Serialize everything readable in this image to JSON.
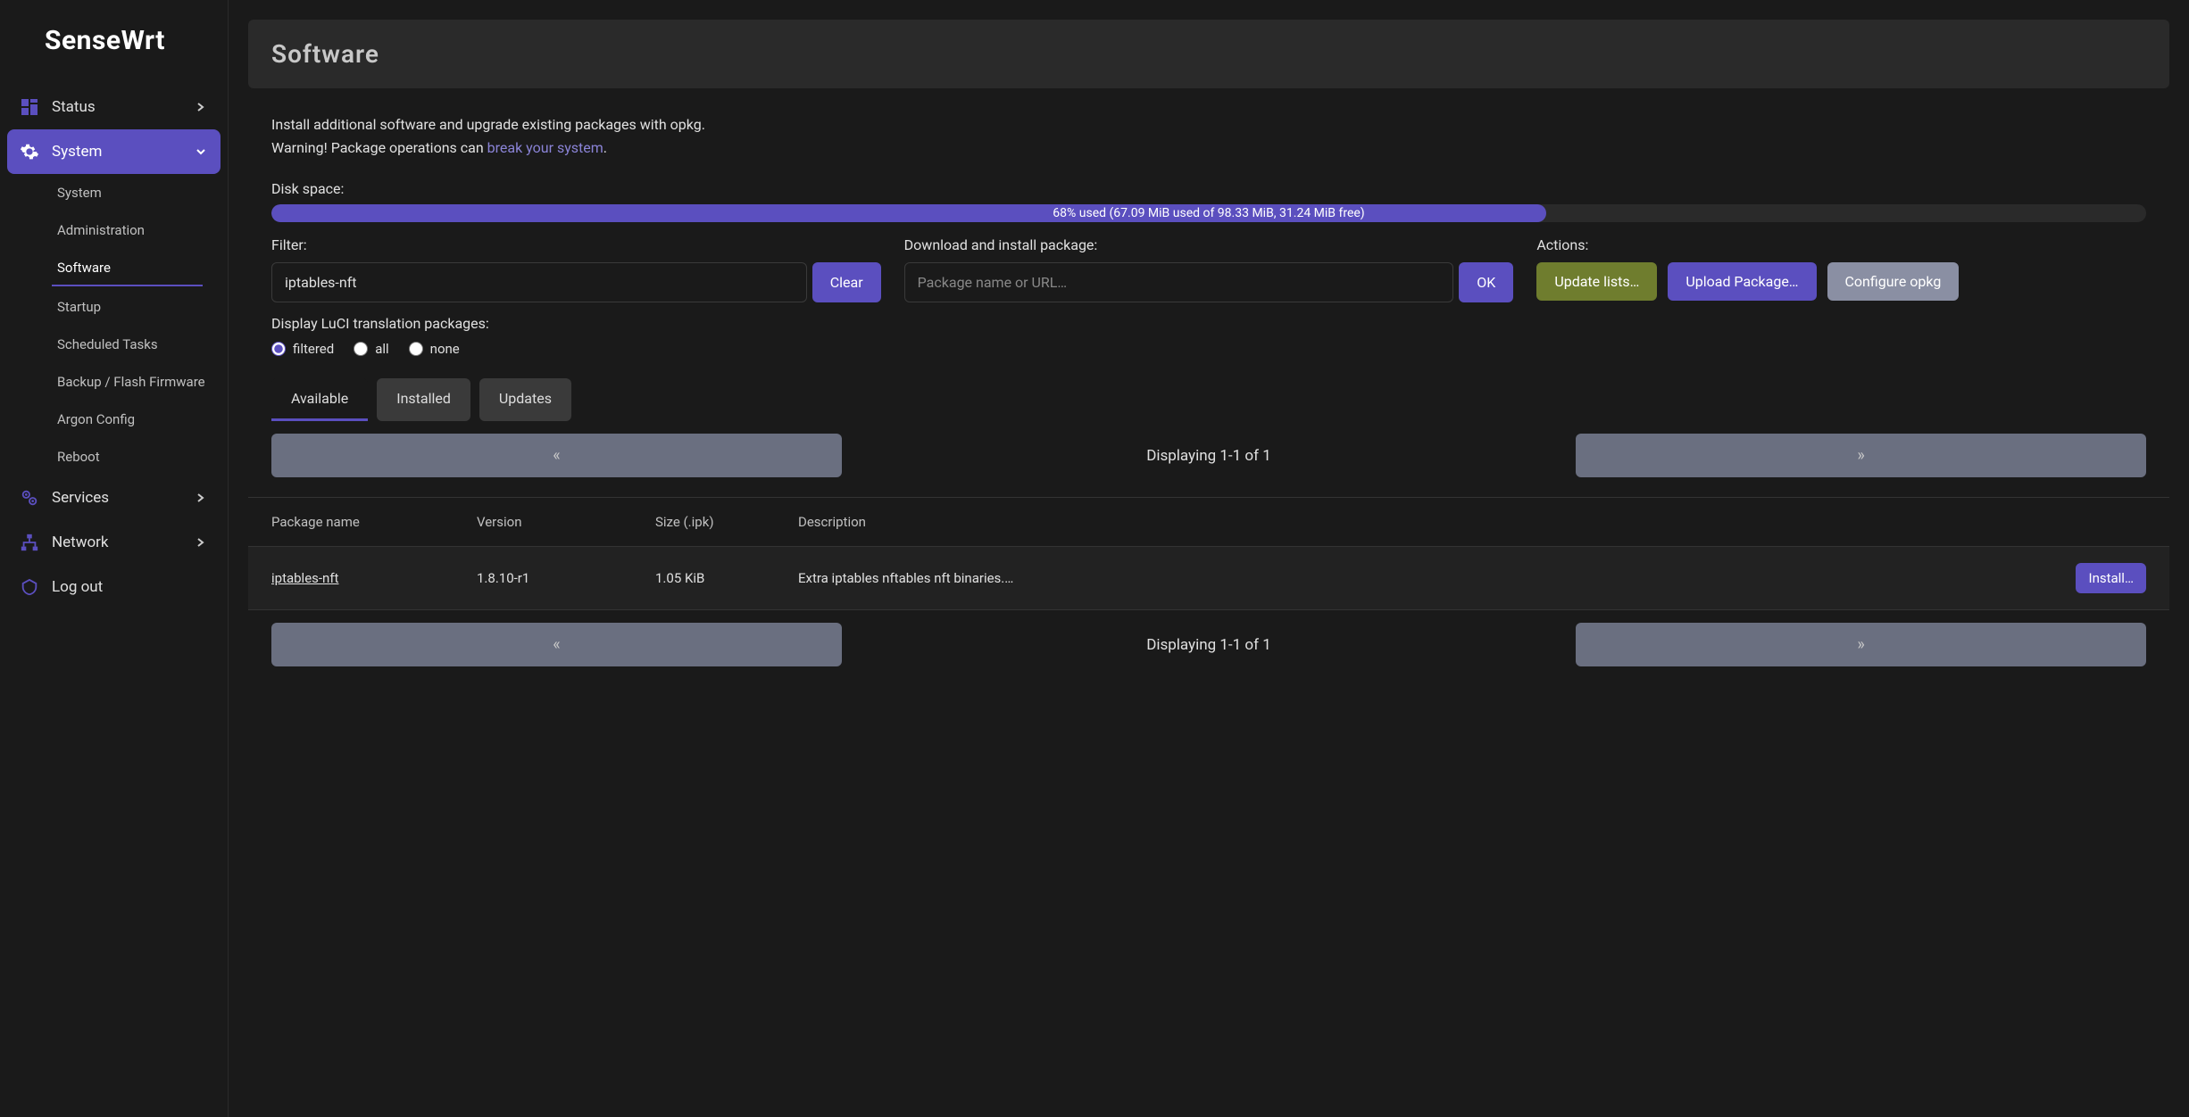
{
  "brand": "SenseWrt",
  "sidebar": {
    "items": [
      {
        "label": "Status",
        "icon": "dashboard-icon"
      },
      {
        "label": "System",
        "icon": "gear-icon"
      },
      {
        "label": "Services",
        "icon": "gears-icon"
      },
      {
        "label": "Network",
        "icon": "network-icon"
      },
      {
        "label": "Log out",
        "icon": "logout-icon"
      }
    ],
    "system_sub": [
      {
        "label": "System"
      },
      {
        "label": "Administration"
      },
      {
        "label": "Software"
      },
      {
        "label": "Startup"
      },
      {
        "label": "Scheduled Tasks"
      },
      {
        "label": "Backup / Flash Firmware"
      },
      {
        "label": "Argon Config"
      },
      {
        "label": "Reboot"
      }
    ]
  },
  "page": {
    "title": "Software",
    "intro_line1": "Install additional software and upgrade existing packages with opkg.",
    "intro_line2_prefix": "Warning! Package operations can ",
    "intro_line2_link": "break your system",
    "intro_line2_suffix": "."
  },
  "disk": {
    "label": "Disk space:",
    "percent": 68,
    "text": "68% used (67.09 MiB used of 98.33 MiB, 31.24 MiB free)"
  },
  "filter": {
    "label": "Filter:",
    "value": "iptables-nft",
    "clear": "Clear"
  },
  "download": {
    "label": "Download and install package:",
    "placeholder": "Package name or URL…",
    "ok": "OK"
  },
  "actions": {
    "label": "Actions:",
    "update": "Update lists…",
    "upload": "Upload Package…",
    "configure": "Configure opkg"
  },
  "translation": {
    "label": "Display LuCI translation packages:",
    "options": [
      "filtered",
      "all",
      "none"
    ],
    "selected": "filtered"
  },
  "tabs": {
    "available": "Available",
    "installed": "Installed",
    "updates": "Updates"
  },
  "pager": {
    "prev": "«",
    "next": "»",
    "info": "Displaying 1-1 of 1"
  },
  "table": {
    "headers": {
      "name": "Package name",
      "version": "Version",
      "size": "Size (.ipk)",
      "description": "Description"
    },
    "rows": [
      {
        "name": "iptables-nft",
        "version": "1.8.10-r1",
        "size": "1.05 KiB",
        "description": "Extra iptables nftables nft binaries.…",
        "action": "Install…"
      }
    ]
  }
}
